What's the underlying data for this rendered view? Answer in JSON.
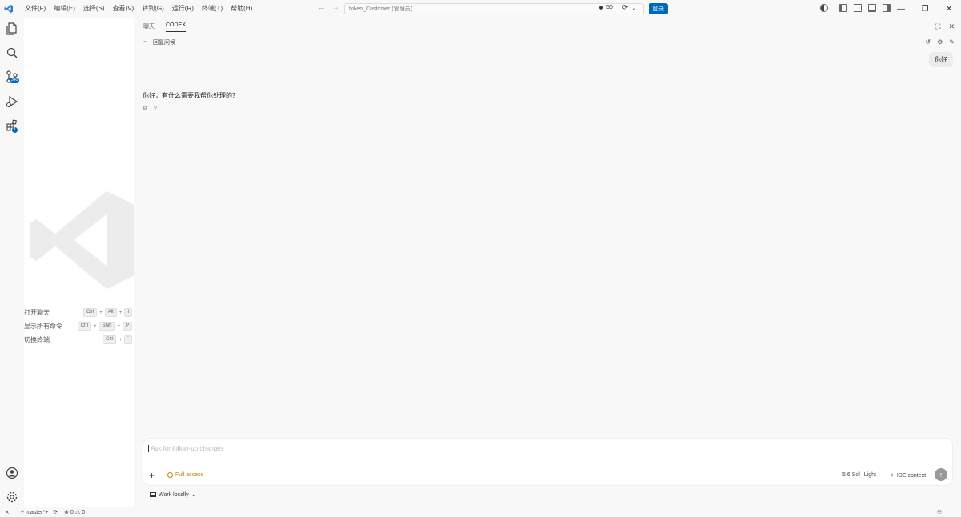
{
  "menus": [
    "文件(F)",
    "编辑(E)",
    "选择(S)",
    "查看(V)",
    "转到(G)",
    "运行(R)",
    "终端(T)",
    "帮助(H)"
  ],
  "command_center": {
    "text": "token_Customer (管理员)",
    "count": "50",
    "login_label": "登录"
  },
  "activity": {
    "source_control_badge": "340",
    "extensions_badge": "1"
  },
  "sidebar": {
    "shortcuts": [
      {
        "label": "打开聊天",
        "keys": [
          "Ctrl",
          "+",
          "Alt",
          "+",
          "I"
        ]
      },
      {
        "label": "显示所有命令",
        "keys": [
          "Ctrl",
          "+",
          "Shift",
          "+",
          "P"
        ]
      },
      {
        "label": "切换终端",
        "keys": [
          "Ctrl",
          "+",
          "`"
        ]
      }
    ]
  },
  "panel": {
    "tabs": [
      "聊天",
      "CODEX"
    ],
    "back_label": "回复问候",
    "user_message": "你好",
    "assistant_message": "你好，有什么需要我帮你处理的？"
  },
  "composer": {
    "placeholder": "Ask for follow-up changes",
    "access_label": "Full access",
    "model": "5.6 Sol",
    "mode": "Light",
    "ide_context": "IDE context",
    "work_locally": "Work locally"
  },
  "statusbar": {
    "branch": "master*+",
    "errors": "0",
    "warnings": "0"
  }
}
